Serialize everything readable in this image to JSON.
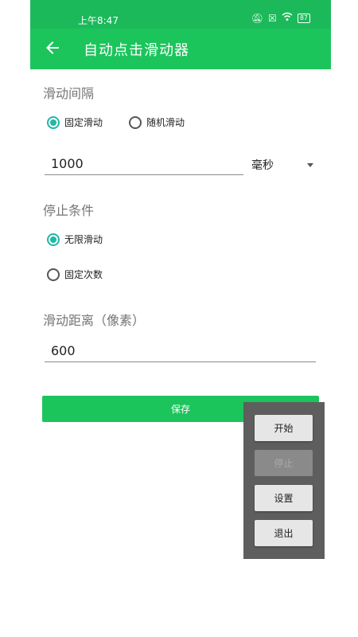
{
  "status_bar": {
    "time": "上午8:47",
    "battery": "87"
  },
  "app_bar": {
    "title": "自动点击滑动器"
  },
  "interval": {
    "title": "滑动间隔",
    "option_fixed": "固定滑动",
    "option_random": "随机滑动",
    "selected": "fixed",
    "value": "1000",
    "unit": "毫秒"
  },
  "stop": {
    "title": "停止条件",
    "option_unlimited": "无限滑动",
    "option_count": "固定次数",
    "selected": "unlimited"
  },
  "distance": {
    "title": "滑动距离（像素）",
    "value": "600"
  },
  "save_label": "保存",
  "overlay": {
    "start": "开始",
    "stop": "停止",
    "settings": "设置",
    "exit": "退出"
  },
  "colors": {
    "accent": "#1cc45c",
    "radio_accent": "#21b8a6",
    "overlay_bg": "#5e5e5e"
  }
}
